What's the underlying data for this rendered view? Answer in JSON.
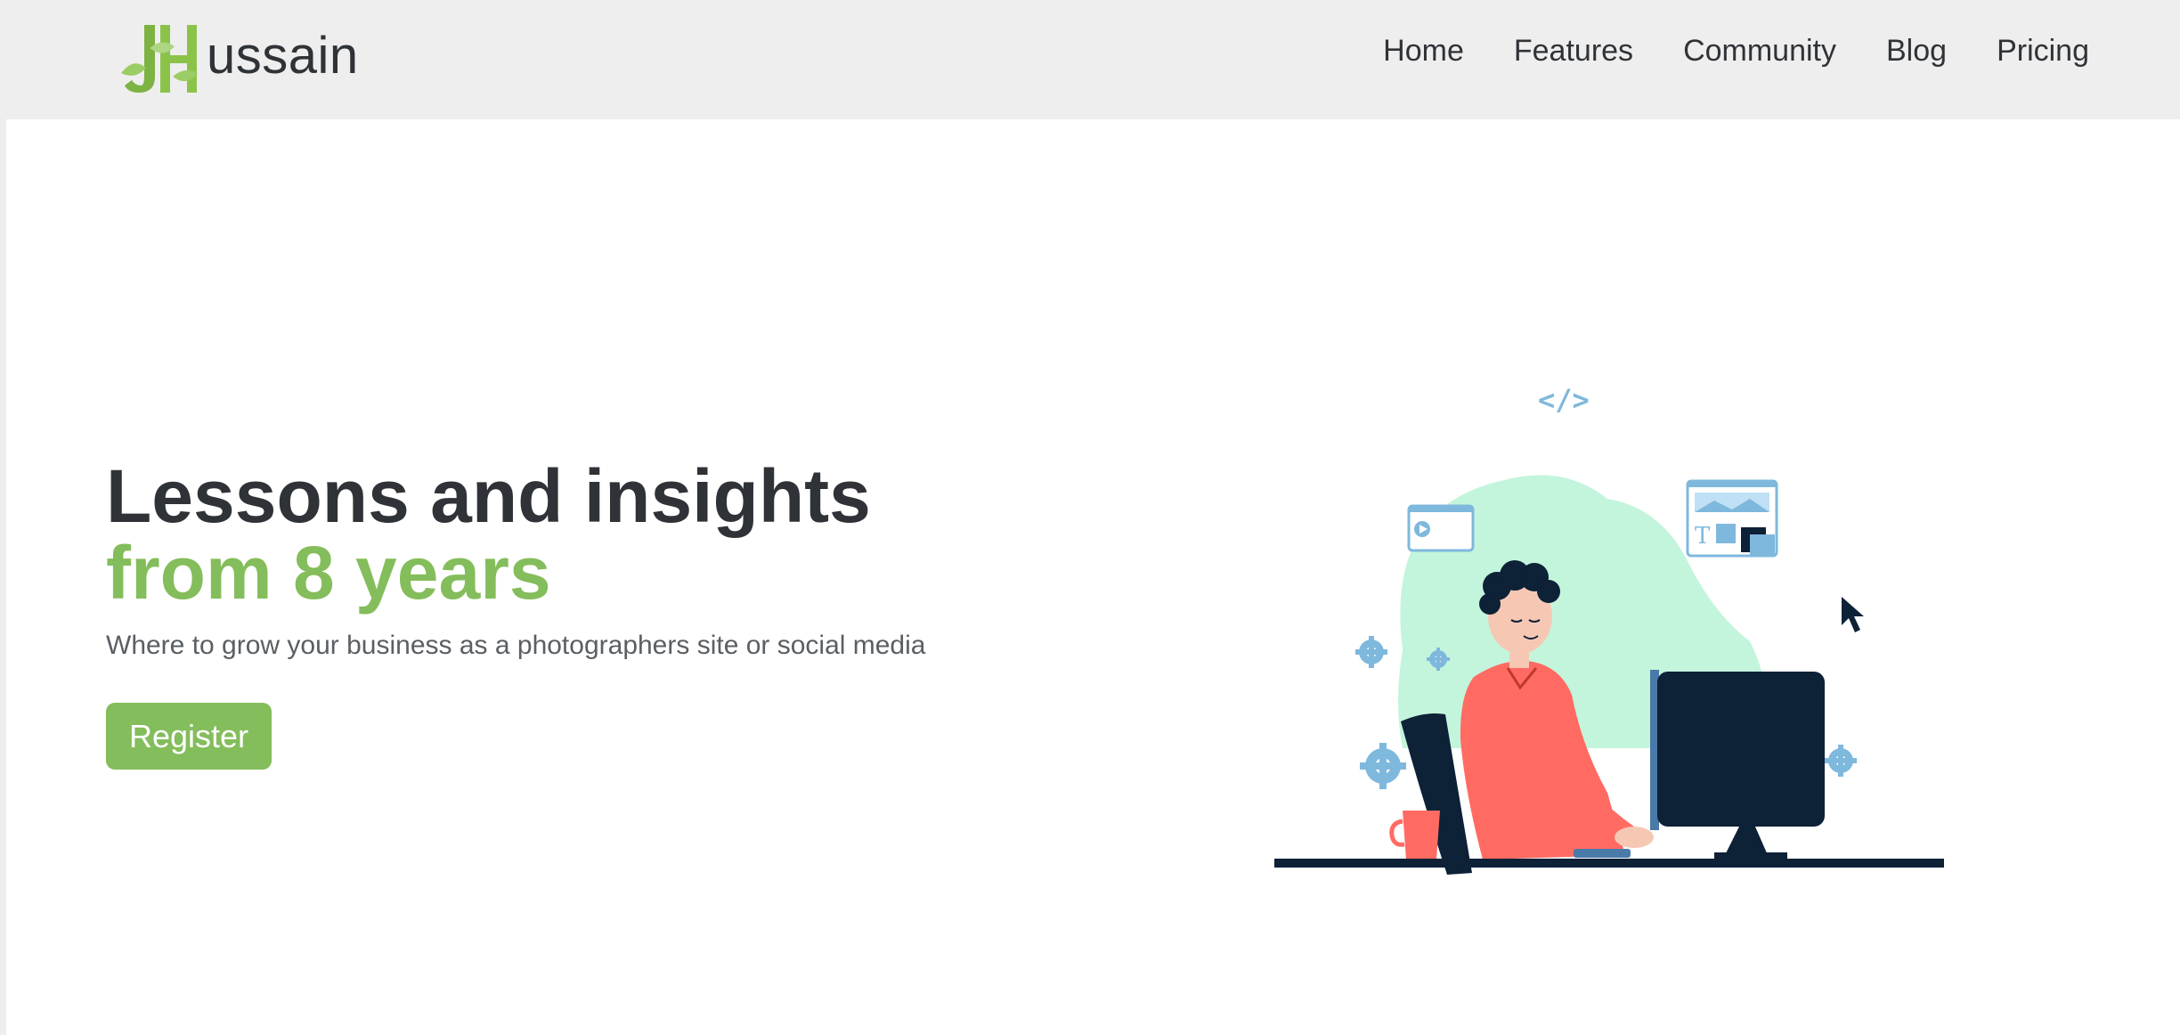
{
  "header": {
    "logo_text": "ussain",
    "logo_icon": "leaf-monogram-logo-icon",
    "nav": [
      {
        "label": "Home"
      },
      {
        "label": "Features"
      },
      {
        "label": "Community"
      },
      {
        "label": "Blog"
      },
      {
        "label": "Pricing"
      }
    ]
  },
  "hero": {
    "title_line1": "Lessons and insights",
    "title_line2": "from 8 years",
    "subtitle": "Where to grow your business as a photographers site or social media",
    "register_label": "Register"
  },
  "illustration": {
    "code_tag": "</>",
    "icons": [
      "code-tag-icon",
      "video-window-icon",
      "image-editor-window-icon",
      "mouse-cursor-icon",
      "gear-icon"
    ]
  },
  "colors": {
    "accent": "#84bd5b",
    "heading": "#2f3337",
    "header_bg": "#eeeeee",
    "blob": "#c3f5dc",
    "shirt": "#ff6b63",
    "navy": "#0d2137",
    "icon_blue": "#7fb8dd"
  }
}
